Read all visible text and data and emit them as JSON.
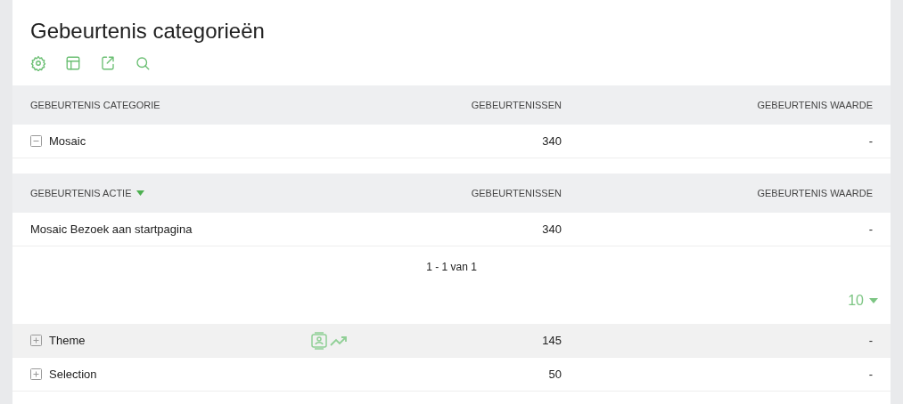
{
  "title": "Gebeurtenis categorieën",
  "toolbar": [
    {
      "kind": "settings"
    },
    {
      "kind": "table"
    },
    {
      "kind": "export"
    },
    {
      "kind": "search"
    }
  ],
  "columns": [
    "GEBEURTENIS CATEGORIE",
    "GEBEURTENISSEN",
    "GEBEURTENIS WAARDE"
  ],
  "rows": [
    {
      "label": "Mosaic",
      "expanded": true,
      "hovered": false,
      "events": "340",
      "value": "-",
      "subtable": {
        "columns": [
          {
            "label": "GEBEURTENIS ACTIE",
            "sorted": true
          },
          {
            "label": "GEBEURTENISSEN",
            "sorted": false
          },
          {
            "label": "GEBEURTENIS WAARDE",
            "sorted": false
          }
        ],
        "rows": [
          {
            "label": "Mosaic Bezoek aan startpagina",
            "events": "340",
            "value": "-"
          }
        ],
        "pagination": "1 - 1 van 1",
        "limit": "10"
      }
    },
    {
      "label": "Theme",
      "expanded": false,
      "hovered": true,
      "events": "145",
      "value": "-"
    },
    {
      "label": "Selection",
      "expanded": false,
      "hovered": false,
      "events": "50",
      "value": "-"
    }
  ]
}
